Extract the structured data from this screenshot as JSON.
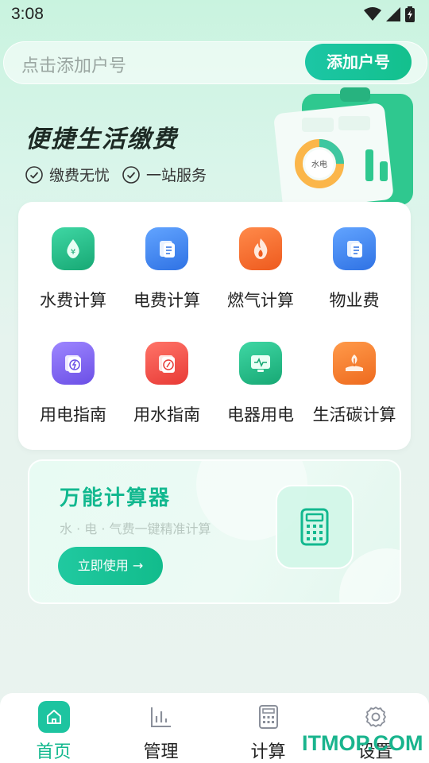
{
  "status_bar": {
    "time": "3:08"
  },
  "search": {
    "placeholder": "点击添加户号",
    "button_label": "添加户号"
  },
  "banner": {
    "title": "便捷生活缴费",
    "tags": [
      "缴费无忧",
      "一站服务"
    ],
    "illustration_label": "水电"
  },
  "services": [
    {
      "label": "水费计算",
      "icon": "water-drop-icon",
      "color": "#21b884"
    },
    {
      "label": "电费计算",
      "icon": "bill-icon",
      "color": "#3f86f0"
    },
    {
      "label": "燃气计算",
      "icon": "flame-icon",
      "color": "#f26a2c"
    },
    {
      "label": "物业费",
      "icon": "document-icon",
      "color": "#3f86f0"
    },
    {
      "label": "用电指南",
      "icon": "lightning-icon",
      "color": "#7b61f0"
    },
    {
      "label": "用水指南",
      "icon": "compass-icon",
      "color": "#f24f46"
    },
    {
      "label": "电器用电",
      "icon": "monitor-icon",
      "color": "#21b884"
    },
    {
      "label": "生活碳计算",
      "icon": "leaf-hand-icon",
      "color": "#f2752c"
    }
  ],
  "calculator": {
    "title": "万能计算器",
    "subtitle": "水 · 电 · 气费一键精准计算",
    "button_label": "立即使用 →"
  },
  "nav": [
    {
      "label": "首页",
      "icon": "home-icon",
      "active": true
    },
    {
      "label": "管理",
      "icon": "bar-chart-icon",
      "active": false
    },
    {
      "label": "计算",
      "icon": "calculator-icon",
      "active": false
    },
    {
      "label": "设置",
      "icon": "gear-icon",
      "active": false
    }
  ],
  "colors": {
    "accent": "#13c08d",
    "text": "#222222"
  },
  "watermark": "ITMOP.COM"
}
